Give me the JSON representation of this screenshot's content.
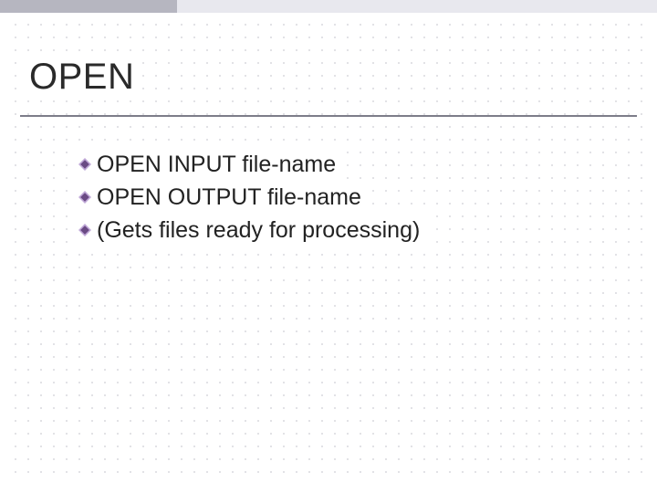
{
  "title": "OPEN",
  "bullets": [
    "OPEN INPUT file-name",
    "OPEN OUTPUT file-name",
    "(Gets files ready for processing)"
  ],
  "colors": {
    "topbar_left": "#b6b6c0",
    "topbar_right": "#e8e8ee",
    "rule": "#7d7d89",
    "bullet_fill": "#6a4a84",
    "bullet_edge": "#c0a8d8",
    "text": "#222222"
  }
}
